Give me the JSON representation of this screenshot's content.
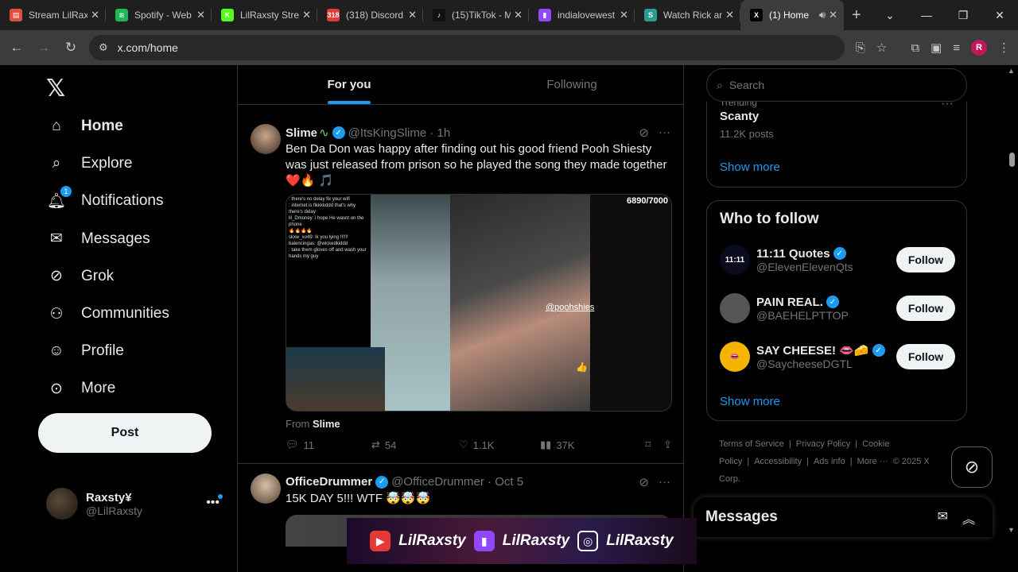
{
  "browser": {
    "tabs": [
      {
        "label": "Stream LilRax",
        "color": "#e04f3c",
        "glyph": "▤"
      },
      {
        "label": "Spotify - Web",
        "color": "#1db954",
        "glyph": "≋"
      },
      {
        "label": "LilRaxsty Stre",
        "color": "#53fc18",
        "glyph": "K"
      },
      {
        "label": "(318) Discord",
        "color": "#e53935",
        "glyph": "318"
      },
      {
        "label": "(15)TikTok - M",
        "color": "#111111",
        "glyph": "♪"
      },
      {
        "label": "indialovewest",
        "color": "#9146ff",
        "glyph": "▮"
      },
      {
        "label": "Watch Rick an",
        "color": "#2a9d8f",
        "glyph": "S"
      },
      {
        "label": "(1) Home",
        "color": "#000000",
        "glyph": "X",
        "active": true
      }
    ],
    "url": "x.com/home",
    "profile_initial": "R"
  },
  "nav": {
    "items": [
      {
        "label": "Home",
        "icon": "home-icon"
      },
      {
        "label": "Explore",
        "icon": "search-icon"
      },
      {
        "label": "Notifications",
        "icon": "bell-icon",
        "badge": "1"
      },
      {
        "label": "Messages",
        "icon": "envelope-icon"
      },
      {
        "label": "Grok",
        "icon": "grok-icon"
      },
      {
        "label": "Communities",
        "icon": "communities-icon"
      },
      {
        "label": "Profile",
        "icon": "person-icon"
      },
      {
        "label": "More",
        "icon": "more-circle-icon"
      }
    ],
    "post_label": "Post",
    "user": {
      "name": "Raxsty¥",
      "handle": "@LilRaxsty"
    }
  },
  "feed": {
    "tabs": [
      "For you",
      "Following"
    ],
    "tweets": [
      {
        "name": "Slime",
        "handle": "@ItsKingSlime",
        "time": "1h",
        "text": "Ben Da Don was happy after finding out his good friend Pooh Shiesty was just released from prison so he played the song they made together ❤️🔥 🎵",
        "media": {
          "counter": "6890/7000",
          "tag": "@poohshies",
          "chat": [
            ": there's no delay fix your wifi",
            ": internet is fikkkkddd that's why there's delay",
            "lil_Dmoney: i hope He wasnt on the phone",
            "🔥🔥🔥🔥",
            "skxw_xo49: Ik you lying !!!!!!",
            "balencingas: @wickedkiddd",
            ": take them gloves off and wash your hands my guy"
          ]
        },
        "from_prefix": "From",
        "from_name": "Slime",
        "stats": {
          "replies": "11",
          "reposts": "54",
          "likes": "1.1K",
          "views": "37K"
        }
      },
      {
        "name": "OfficeDrummer",
        "handle": "@OfficeDrummer",
        "time": "Oct 5",
        "text": "15K DAY 5!!! WTF 🤯🤯🤯"
      }
    ]
  },
  "right": {
    "search_placeholder": "Search",
    "trend": {
      "category": "Trending",
      "name": "Scanty",
      "posts": "11.2K posts"
    },
    "show_more": "Show more",
    "who_to_follow_title": "Who to follow",
    "follow_label": "Follow",
    "suggestions": [
      {
        "name": "11:11 Quotes",
        "handle": "@ElevenElevenQts",
        "avatar_color": "#0b0b1f",
        "avatar_text": "11:11"
      },
      {
        "name": "PAIN REAL.",
        "handle": "@BAEHELPTTOP",
        "avatar_color": "#555555",
        "avatar_text": ""
      },
      {
        "name": "SAY CHEESE! 👄🧀",
        "handle": "@SaycheeseDGTL",
        "avatar_color": "#f4b400",
        "avatar_text": "👄"
      }
    ],
    "footer": [
      "Terms of Service",
      "|",
      "Privacy Policy",
      "|",
      "Cookie Policy",
      "|",
      "Accessibility",
      "|",
      "Ads info",
      "|",
      "More ···",
      "© 2025 X Corp."
    ],
    "messages_title": "Messages"
  },
  "overlay": {
    "handles": [
      "LilRaxsty",
      "LilRaxsty",
      "LilRaxsty"
    ]
  }
}
